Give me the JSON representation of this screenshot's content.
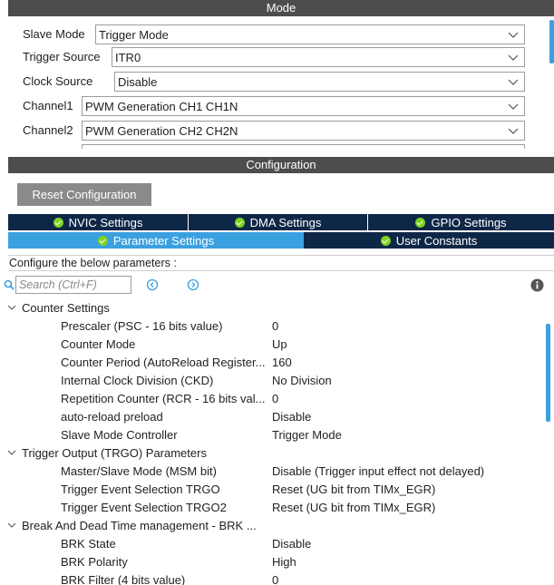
{
  "mode": {
    "header": "Mode",
    "rows": [
      {
        "label": "Slave Mode",
        "value": "Trigger Mode"
      },
      {
        "label": "Trigger Source",
        "value": "ITR0"
      },
      {
        "label": "Clock Source",
        "value": "Disable"
      },
      {
        "label": "Channel1",
        "value": "PWM Generation CH1 CH1N"
      },
      {
        "label": "Channel2",
        "value": "PWM Generation CH2 CH2N"
      }
    ]
  },
  "config": {
    "header": "Configuration",
    "reset_label": "Reset Configuration",
    "tabs_top": [
      "NVIC Settings",
      "DMA Settings",
      "GPIO Settings"
    ],
    "tabs_bottom": [
      "Parameter Settings",
      "User Constants"
    ],
    "caption": "Configure the below parameters :",
    "search_placeholder": "Search (Ctrl+F)"
  },
  "tree": {
    "groups": [
      {
        "label": "Counter Settings",
        "params": [
          {
            "label": "Prescaler (PSC - 16 bits value)",
            "value": "0"
          },
          {
            "label": "Counter Mode",
            "value": "Up"
          },
          {
            "label": "Counter Period (AutoReload Register...",
            "value": "160"
          },
          {
            "label": "Internal Clock Division (CKD)",
            "value": "No Division"
          },
          {
            "label": "Repetition Counter (RCR - 16 bits val...",
            "value": "0"
          },
          {
            "label": "auto-reload preload",
            "value": "Disable"
          },
          {
            "label": "Slave Mode Controller",
            "value": "Trigger Mode"
          }
        ]
      },
      {
        "label": "Trigger Output (TRGO) Parameters",
        "params": [
          {
            "label": "Master/Slave Mode (MSM bit)",
            "value": "Disable (Trigger input effect not delayed)"
          },
          {
            "label": "Trigger Event Selection TRGO",
            "value": "Reset (UG bit from TIMx_EGR)"
          },
          {
            "label": "Trigger Event Selection TRGO2",
            "value": "Reset (UG bit from TIMx_EGR)"
          }
        ]
      },
      {
        "label": "Break And Dead Time management - BRK ...",
        "params": [
          {
            "label": "BRK State",
            "value": "Disable"
          },
          {
            "label": "BRK Polarity",
            "value": "High"
          },
          {
            "label": "BRK Filter (4 bits value)",
            "value": "0"
          }
        ]
      }
    ]
  },
  "colors": {
    "header_bg": "#4d4d4d",
    "tab_dark": "#0f2747",
    "tab_active": "#3aa0e0",
    "check_green": "#7ed321",
    "button_gray": "#8a8a8a"
  }
}
